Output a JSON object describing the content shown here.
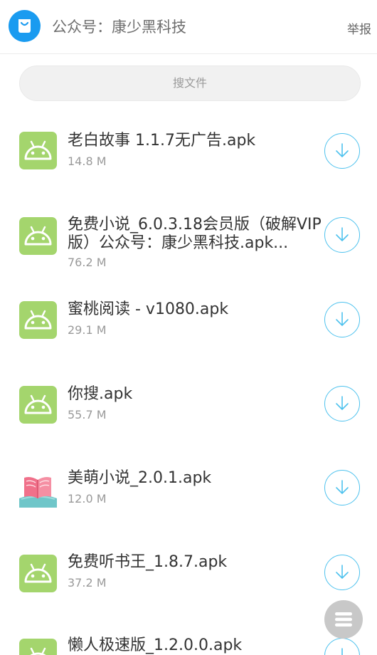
{
  "header": {
    "title": "公众号：康少黑科技",
    "report_label": "举报",
    "app_icon": "shopping-bag-icon"
  },
  "search": {
    "placeholder": "搜文件"
  },
  "files": [
    {
      "name": "老白故事 1.1.7无广告.apk",
      "size": "14.8 M",
      "icon": "android"
    },
    {
      "name": "免费小说_6.0.3.18会员版（破解VIP版）公众号：康少黑科技.apk...",
      "size": "76.2 M",
      "icon": "android"
    },
    {
      "name": "蜜桃阅读 - v1080.apk",
      "size": "29.1 M",
      "icon": "android"
    },
    {
      "name": "你搜.apk",
      "size": "55.7 M",
      "icon": "android"
    },
    {
      "name": "美萌小说_2.0.1.apk",
      "size": "12.0 M",
      "icon": "book"
    },
    {
      "name": "免费听书王_1.8.7.apk",
      "size": "37.2 M",
      "icon": "android"
    },
    {
      "name": "懒人极速版_1.2.0.0.apk",
      "size": "",
      "icon": "android"
    }
  ],
  "colors": {
    "accent": "#1a9bf0",
    "android_green": "#a4d56d",
    "download_ring": "#4ec2ee"
  }
}
